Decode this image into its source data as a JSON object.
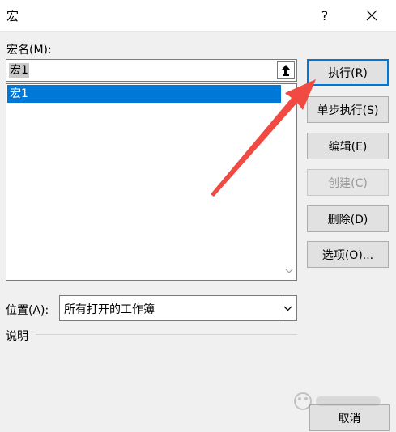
{
  "window": {
    "title": "宏",
    "help_label": "?",
    "icons": {
      "close": "close-icon"
    }
  },
  "macro_name": {
    "label": "宏名(M):",
    "value": "宏1",
    "upload_icon": "upload-arrow-icon"
  },
  "macro_list": {
    "items": [
      {
        "label": "宏1",
        "selected": true
      }
    ],
    "scroll_icons": [
      "chevron-up-icon",
      "chevron-down-icon"
    ]
  },
  "buttons": {
    "run": "执行(R)",
    "step_into": "单步执行(S)",
    "edit": "编辑(E)",
    "create": "创建(C)",
    "delete": "删除(D)",
    "options": "选项(O)...",
    "cancel": "取消"
  },
  "location": {
    "label": "位置(A):",
    "value": "所有打开的工作簿"
  },
  "description": {
    "label": "说明"
  },
  "colors": {
    "selection": "#0078d7",
    "annotation_arrow": "#f04a43",
    "dialog_bg": "#f0f0f0"
  }
}
